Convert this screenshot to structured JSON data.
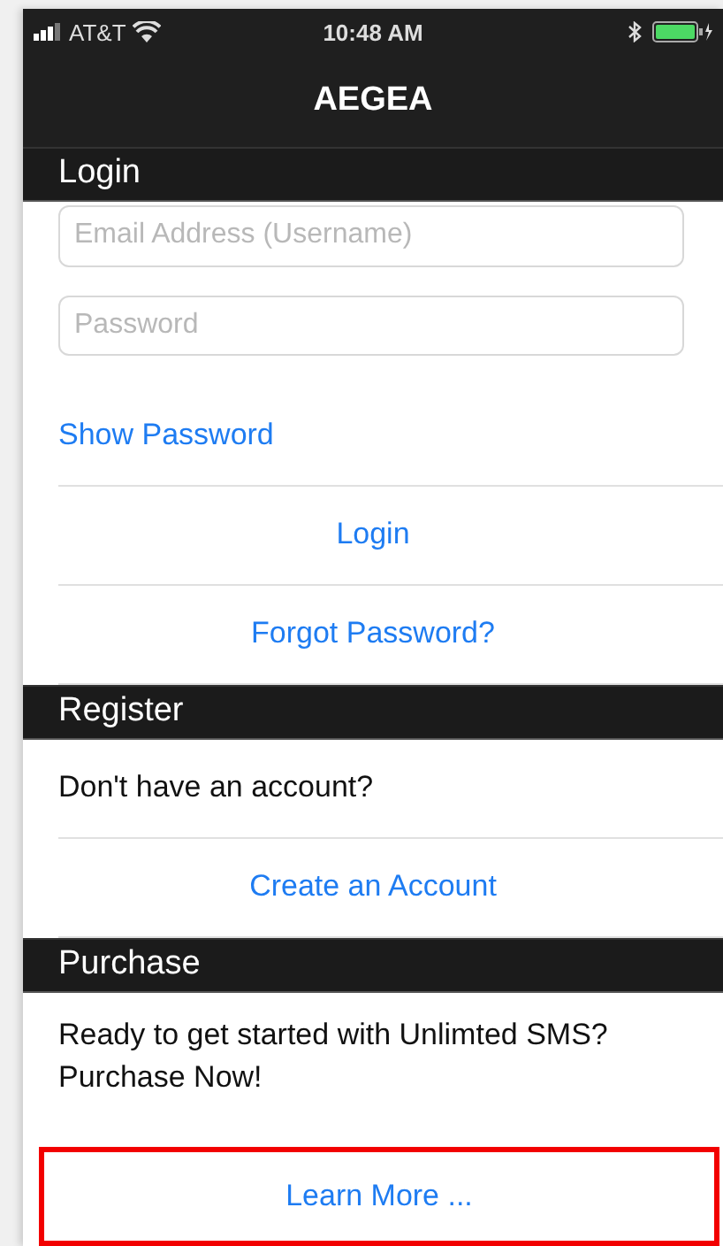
{
  "status_bar": {
    "carrier": "AT&T",
    "time": "10:48 AM"
  },
  "nav_bar": {
    "title": "AEGEA"
  },
  "sections": [
    {
      "title": "Login",
      "rows": [
        {
          "kind": "field",
          "placeholder": "Email Address (Username)"
        },
        {
          "kind": "field",
          "placeholder": "Password"
        },
        {
          "kind": "side_link",
          "label": "Show Password"
        },
        {
          "kind": "link",
          "label": "Login"
        },
        {
          "kind": "link",
          "label": "Forgot Password?"
        }
      ]
    },
    {
      "title": "Register",
      "rows": [
        {
          "kind": "text",
          "label": "Don't have an account?"
        },
        {
          "kind": "link",
          "label": "Create an Account"
        }
      ]
    },
    {
      "title": "Purchase",
      "rows": [
        {
          "kind": "text",
          "label": "Ready to get started with Unlimted SMS? Purchase Now!"
        },
        {
          "kind": "link",
          "label": "Learn More ...",
          "highlighted": true
        }
      ]
    }
  ]
}
